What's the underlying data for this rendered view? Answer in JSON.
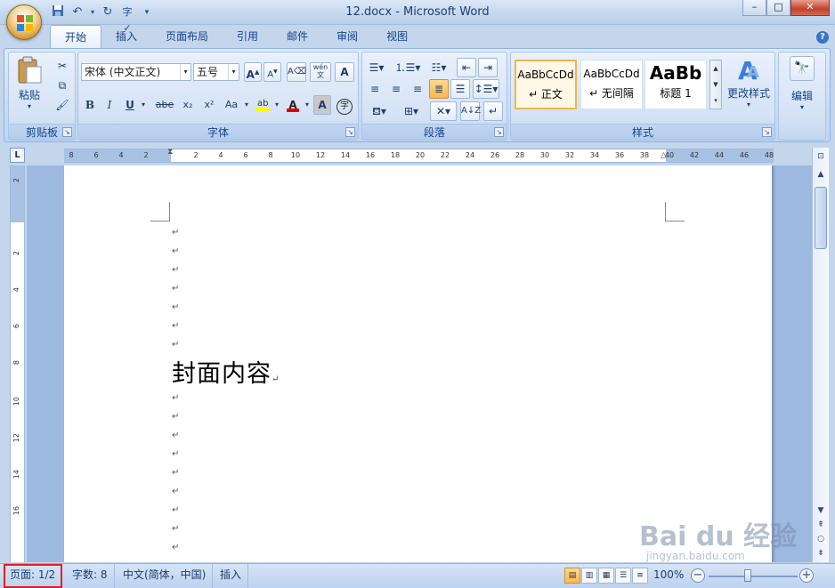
{
  "window": {
    "title": "12.docx - Microsoft Word",
    "controls": {
      "minimize": "–",
      "maximize": "□",
      "close": "✕"
    }
  },
  "quick_access": [
    "save-icon",
    "undo-icon",
    "redo-icon",
    "spelling-icon",
    "customize-icon"
  ],
  "tabs": [
    {
      "label": "开始",
      "active": true
    },
    {
      "label": "插入"
    },
    {
      "label": "页面布局"
    },
    {
      "label": "引用"
    },
    {
      "label": "邮件"
    },
    {
      "label": "审阅"
    },
    {
      "label": "视图"
    }
  ],
  "ribbon": {
    "clipboard": {
      "label": "剪贴板",
      "paste_label": "粘贴"
    },
    "font": {
      "label": "字体",
      "font_name": "宋体 (中文正文)",
      "font_size": "五号",
      "bold": "B",
      "italic": "I",
      "underline": "U",
      "strike": "abe",
      "subscript": "x₂",
      "superscript": "x²",
      "change_case": "Aa",
      "font_color_letter": "A",
      "char_shading": "A",
      "enclose": "字",
      "phonetic": "wén 文",
      "grow": "A",
      "shrink": "A"
    },
    "paragraph": {
      "label": "段落"
    },
    "styles": {
      "label": "样式",
      "items": [
        {
          "sample": "AaBbCcDd",
          "name": "↵ 正文"
        },
        {
          "sample": "AaBbCcDd",
          "name": "↵ 无间隔"
        },
        {
          "sample": "AaBb",
          "name": "标题 1"
        }
      ],
      "change_styles_label": "更改样式"
    },
    "editing": {
      "label": "编辑"
    }
  },
  "ruler": {
    "h_ticks": [
      "8",
      "6",
      "4",
      "2",
      "2",
      "4",
      "6",
      "8",
      "10",
      "12",
      "14",
      "16",
      "18",
      "20",
      "22",
      "24",
      "26",
      "28",
      "30",
      "32",
      "34",
      "36",
      "38",
      "40",
      "42",
      "44",
      "46",
      "48"
    ],
    "v_ticks": [
      "2",
      "2",
      "4",
      "6",
      "8",
      "10",
      "12",
      "14",
      "16"
    ]
  },
  "document": {
    "paragraph_mark": "↵",
    "cover_text": "封面内容"
  },
  "status": {
    "page": "页面: 1/2",
    "word_count": "字数: 8",
    "language": "中文(简体，中国)",
    "insert_mode": "插入",
    "zoom": "100%"
  },
  "watermark": {
    "brand": "Bai du 经验",
    "url": "jingyan.baidu.com"
  },
  "colors": {
    "accent": "#15428b",
    "ribbon_bg": "#c8daf2",
    "highlight_box": "#e02020",
    "selected_style": "#f1b54b"
  }
}
